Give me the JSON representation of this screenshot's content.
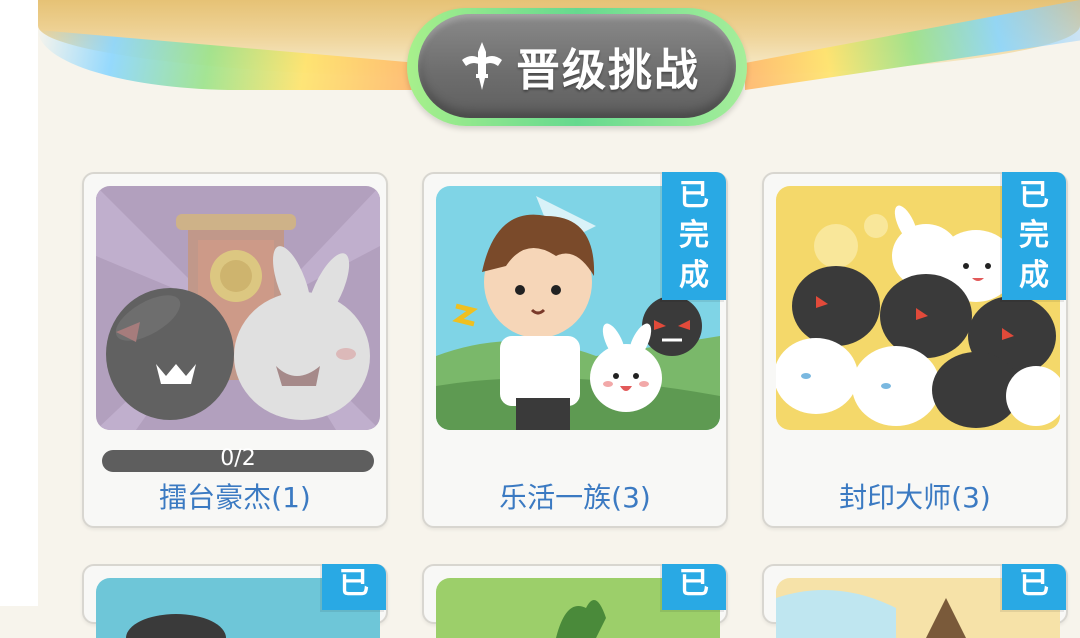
{
  "header": {
    "title": "晋级挑战",
    "icon": "sword-icon"
  },
  "badge_text": [
    "已",
    "完",
    "成"
  ],
  "cards": [
    {
      "name": "擂台豪杰(1)",
      "progress_text": "0/2",
      "progress": 0.0,
      "completed": false,
      "locked_art": true
    },
    {
      "name": "乐活一族(3)",
      "completed": true
    },
    {
      "name": "封印大师(3)",
      "completed": true
    }
  ],
  "row2_badges": [
    "已",
    "已",
    "已"
  ],
  "colors": {
    "badge": "#29a9e4",
    "card_title": "#3b7ac2",
    "title_pill_border": "#66d98f",
    "title_pill_fill": "#6e6e6e",
    "progress_track": "#5e5e5e"
  }
}
